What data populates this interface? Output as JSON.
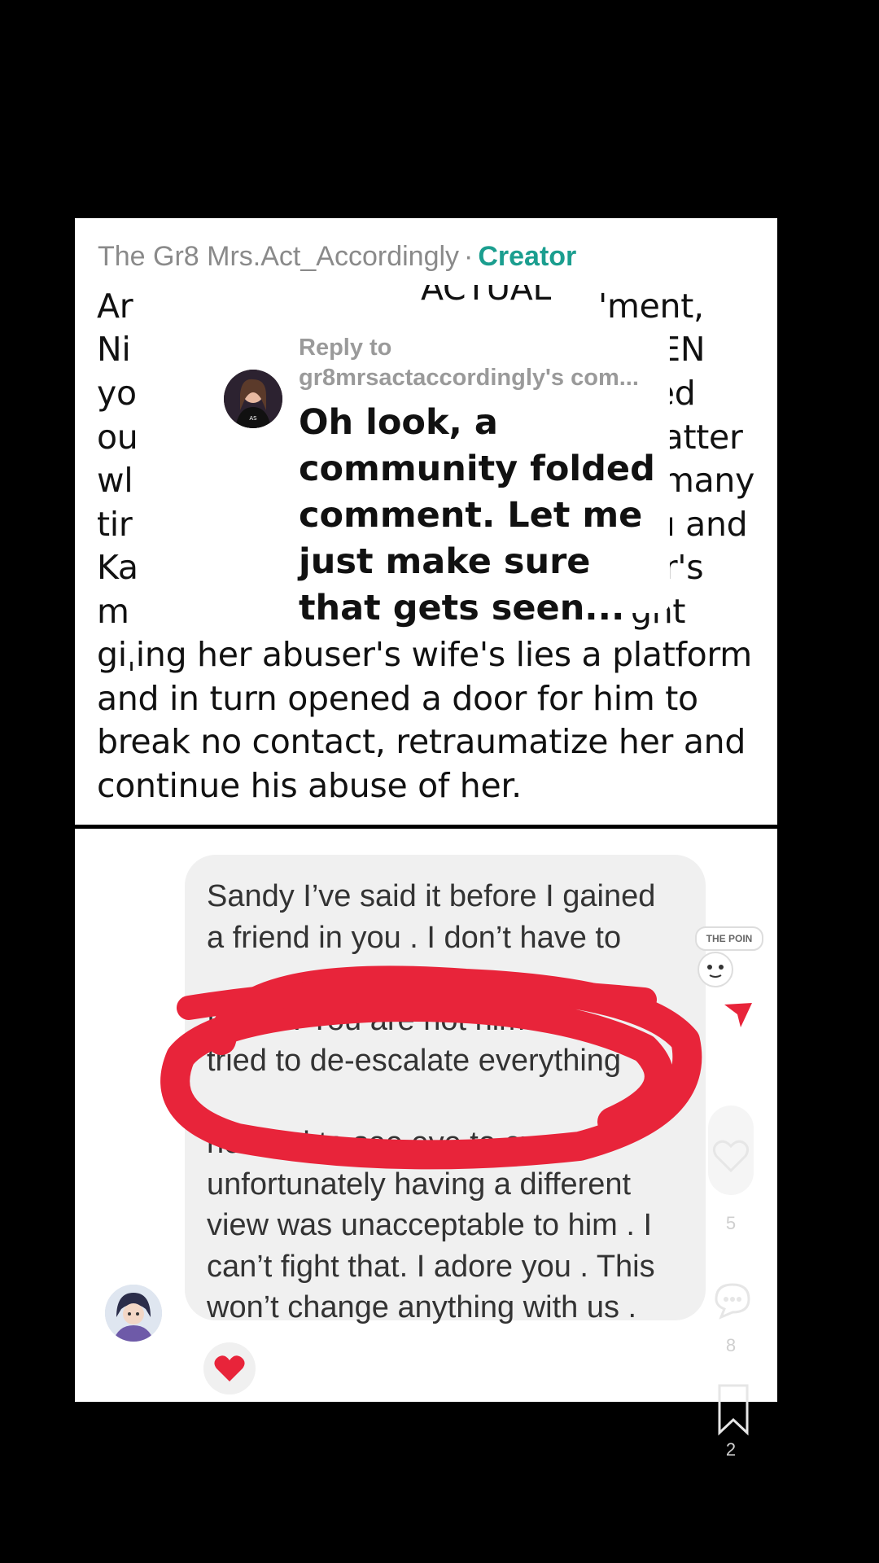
{
  "comment": {
    "author": "The Gr8 Mrs.Act_Accordingly",
    "separator": "·",
    "role": "Creator",
    "lines": [
      "Ar",
      "Ni",
      "yo",
      "ou",
      "wl",
      "tir",
      "Ka",
      "m",
      "giˌing her abuser's wife's lies a platform",
      "and in turn opened a door for him to",
      "break no contact, retraumatize her and",
      "continue his abuse of her."
    ],
    "right_fragments": [
      "'ment,",
      "THEN",
      "ayed",
      "matter",
      "w many",
      "you and",
      "ter's",
      "ght"
    ],
    "top_fragment": "ACTUAL"
  },
  "reply_sticker": {
    "label": "Reply to",
    "handle": "gr8mrsactaccordingly's com...",
    "text": "Oh look, a community folded comment. Let me just make sure that gets seen..."
  },
  "chat": {
    "lines": [
      "Sandy I’ve said it before I gained",
      "a friend in you . I don’t have to",
      "",
      "friend . You are not him. You",
      "tried to de-escalate everything",
      "",
      "headed to see eye to eye.",
      "unfortunately having a different",
      "view was unacceptable to him . I",
      "can’t fight that. I adore you . This",
      "won’t change anything with us ."
    ],
    "reaction": "heart"
  },
  "side": {
    "badge": "THE POIN",
    "like_count": "5",
    "comment_count": "8",
    "save_count": "2"
  },
  "colors": {
    "creator": "#1b9e8f",
    "scribble": "#e8243a",
    "heart": "#e8243a"
  }
}
